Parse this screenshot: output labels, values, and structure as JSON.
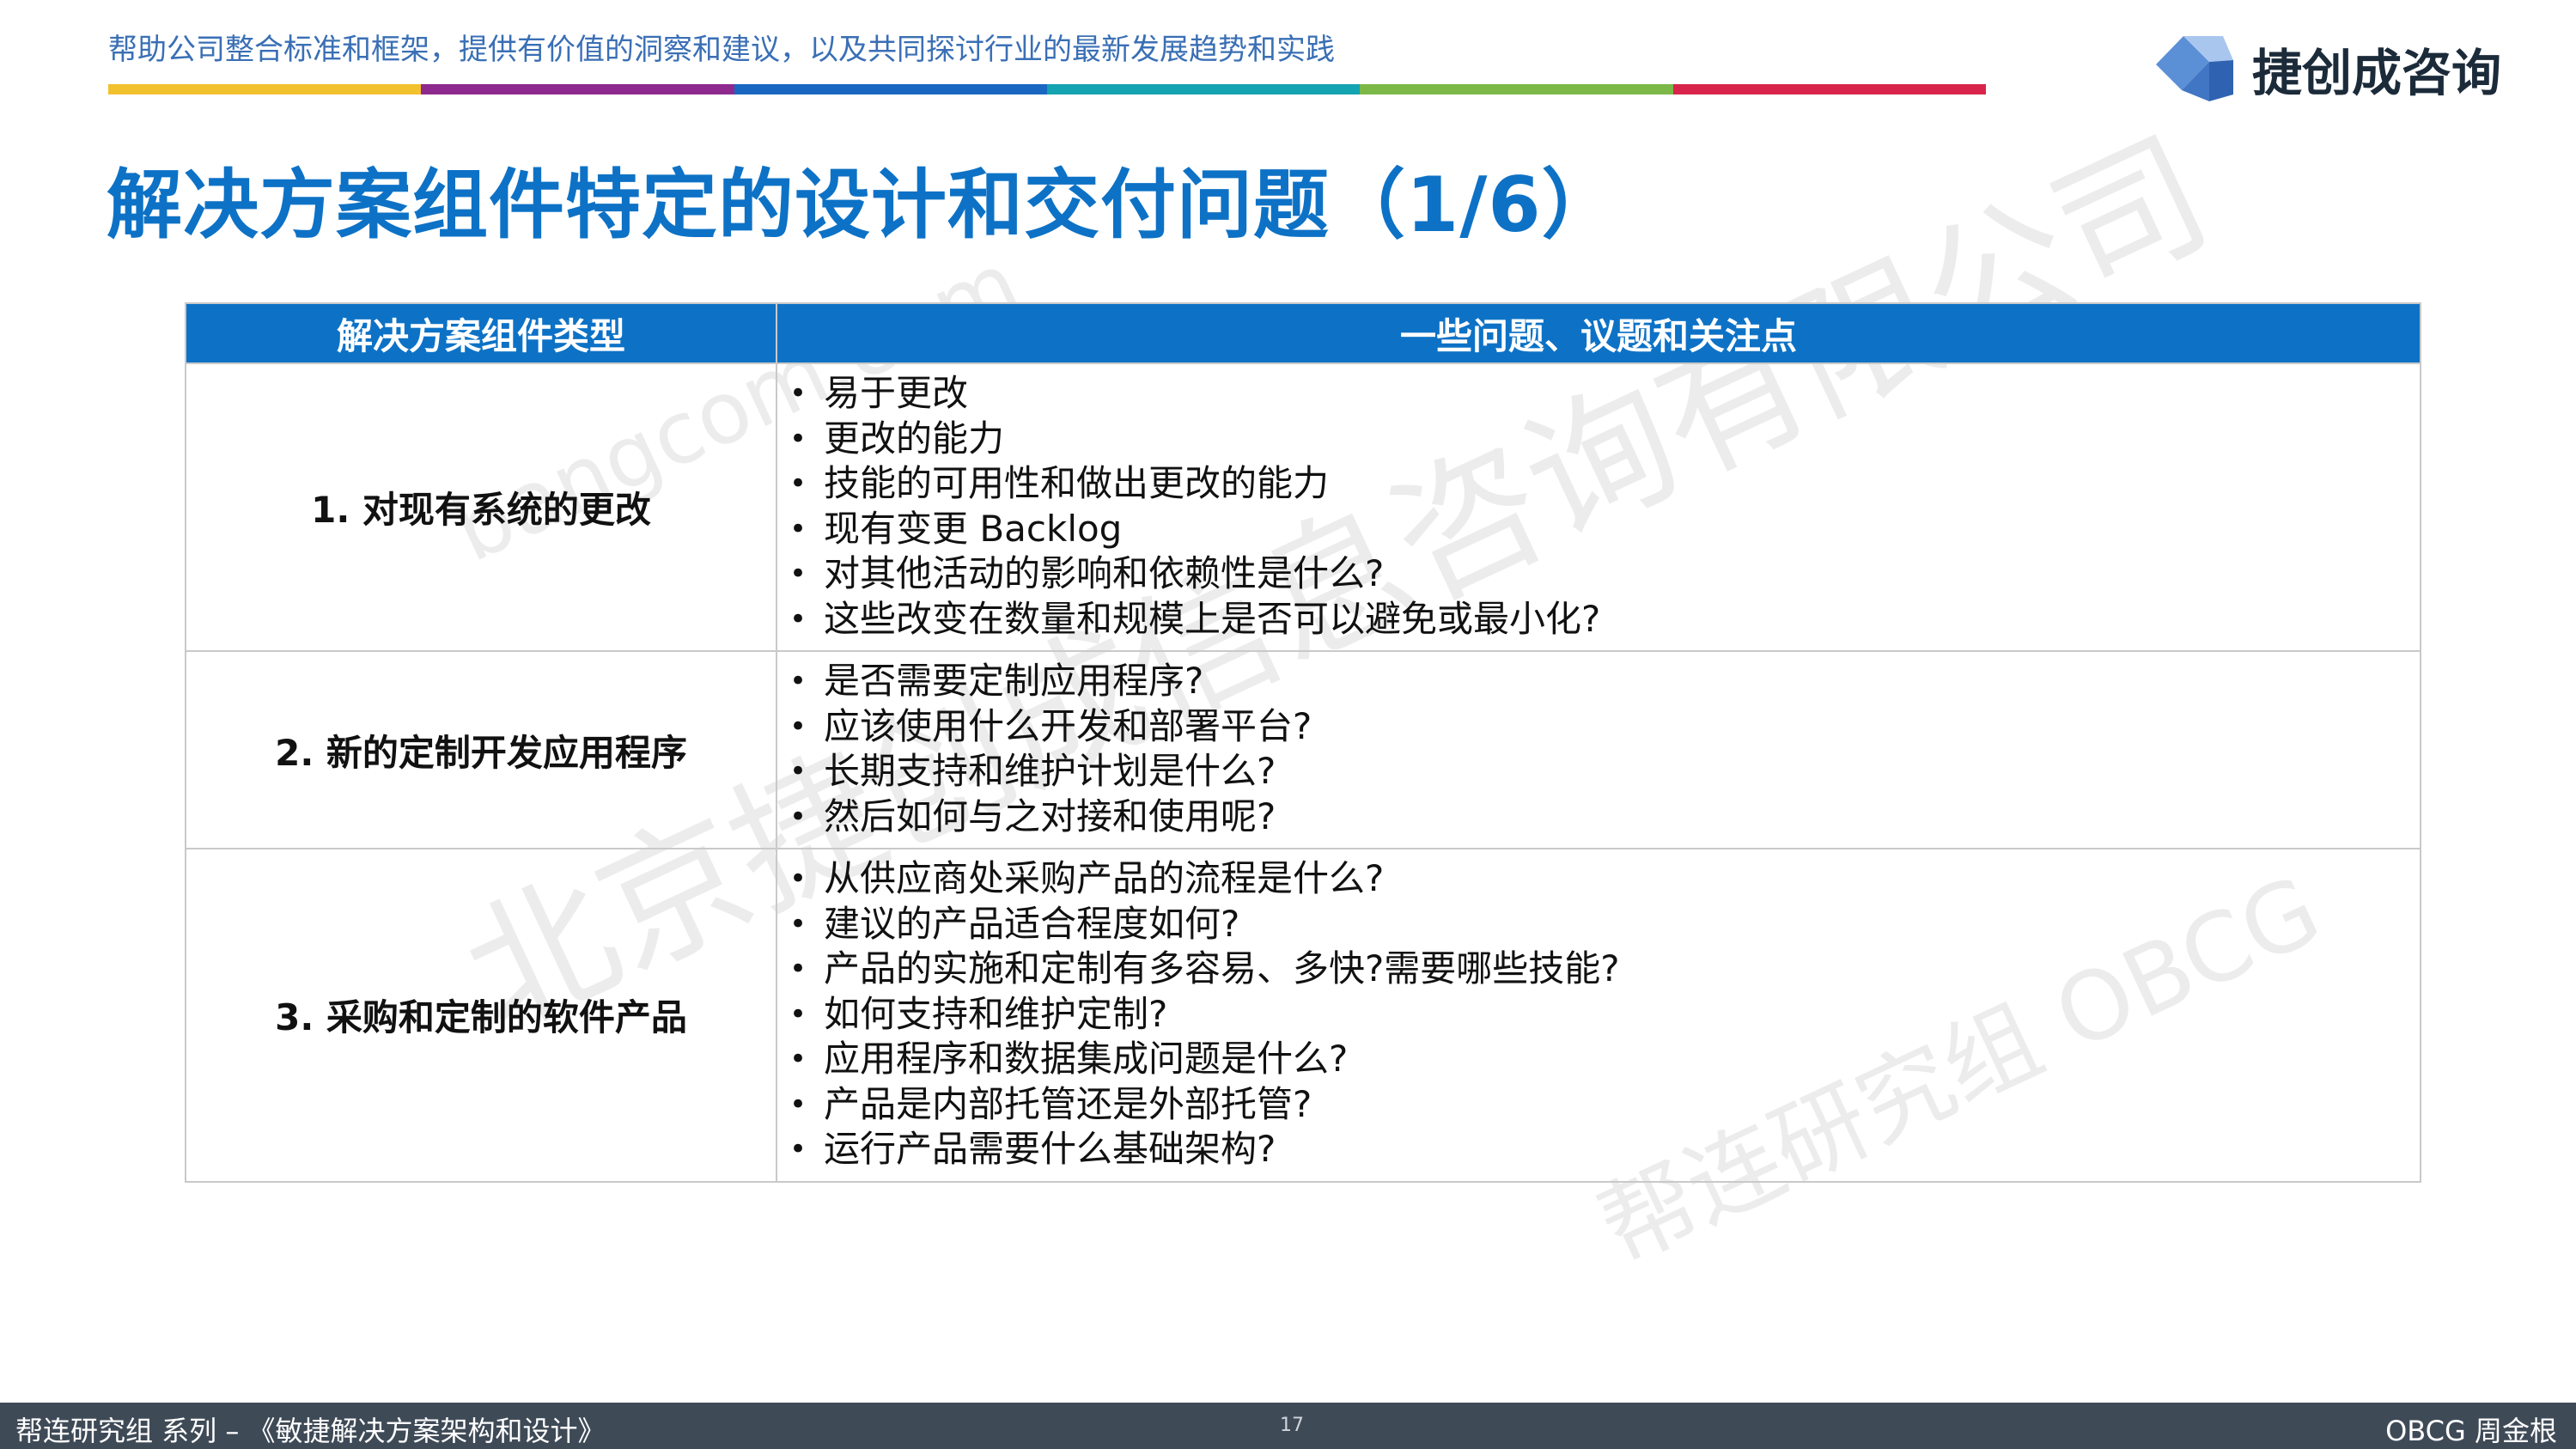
{
  "header": {
    "tagline": "帮助公司整合标准和框架，提供有价值的洞察和建议，以及共同探讨行业的最新发展趋势和实践",
    "bar_colors": [
      "#f2c12e",
      "#8e2a8e",
      "#1a67c2",
      "#14a3b0",
      "#7bb848",
      "#d8244a"
    ],
    "logo_text": "捷创成咨询"
  },
  "title": "解决方案组件特定的设计和交付问题（1/6）",
  "table": {
    "headers": [
      "解决方案组件类型",
      "一些问题、议题和关注点"
    ],
    "rows": [
      {
        "type": "1. 对现有系统的更改",
        "issues": [
          "易于更改",
          "更改的能力",
          "技能的可用性和做出更改的能力",
          "现有变更 Backlog",
          "对其他活动的影响和依赖性是什么?",
          "这些改变在数量和规模上是否可以避免或最小化?"
        ]
      },
      {
        "type": "2. 新的定制开发应用程序",
        "issues": [
          "是否需要定制应用程序?",
          "应该使用什么开发和部署平台?",
          "长期支持和维护计划是什么?",
          "然后如何与之对接和使用呢?"
        ]
      },
      {
        "type": "3. 采购和定制的软件产品",
        "issues": [
          "从供应商处采购产品的流程是什么?",
          "建议的产品适合程度如何?",
          "产品的实施和定制有多容易、多快?需要哪些技能?",
          "如何支持和维护定制?",
          "应用程序和数据集成问题是什么?",
          "产品是内部托管还是外部托管?",
          "运行产品需要什么基础架构?"
        ]
      }
    ]
  },
  "watermarks": [
    "北京捷创成信息咨询有限公司",
    "帮连研究组 OBCG",
    "bangcom.com"
  ],
  "footer": {
    "left": "帮连研究组 系列 – 《敏捷解决方案架构和设计》",
    "page": "17",
    "right": "OBCG 周金根"
  }
}
